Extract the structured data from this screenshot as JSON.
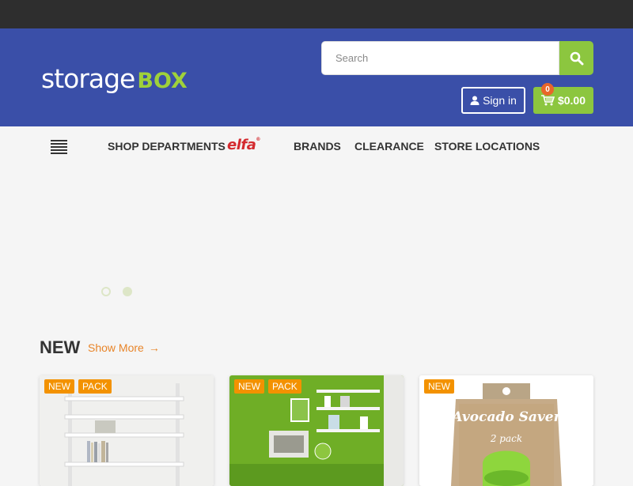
{
  "header": {
    "logo_part1": "storage",
    "logo_part2": "BOX",
    "search_placeholder": "Search",
    "signin_label": "Sign in",
    "cart_total": "$0.00",
    "cart_count": "0"
  },
  "nav": {
    "items": [
      "SHOP DEPARTMENTS",
      "elfa",
      "BRANDS",
      "CLEARANCE",
      "STORE LOCATIONS"
    ]
  },
  "slider": {
    "slide_count": 2,
    "active_index": 1
  },
  "section": {
    "title": "NEW",
    "show_more": "Show More",
    "arrow": "→"
  },
  "products": [
    {
      "badges": [
        "NEW",
        "PACK"
      ],
      "image": "white-shelving-unit"
    },
    {
      "badges": [
        "NEW",
        "PACK"
      ],
      "image": "green-wall-office-shelving"
    },
    {
      "badges": [
        "NEW"
      ],
      "image": "avocado-saver-pack",
      "package_title": "Avocado Saver",
      "package_subtitle": "2 pack"
    }
  ],
  "colors": {
    "topbar": "#2e2e2e",
    "header": "#3a4fa8",
    "accent_green": "#8cc63f",
    "badge_orange": "#f39200",
    "cart_badge": "#e8662a",
    "elfa_red": "#d42a2f"
  }
}
